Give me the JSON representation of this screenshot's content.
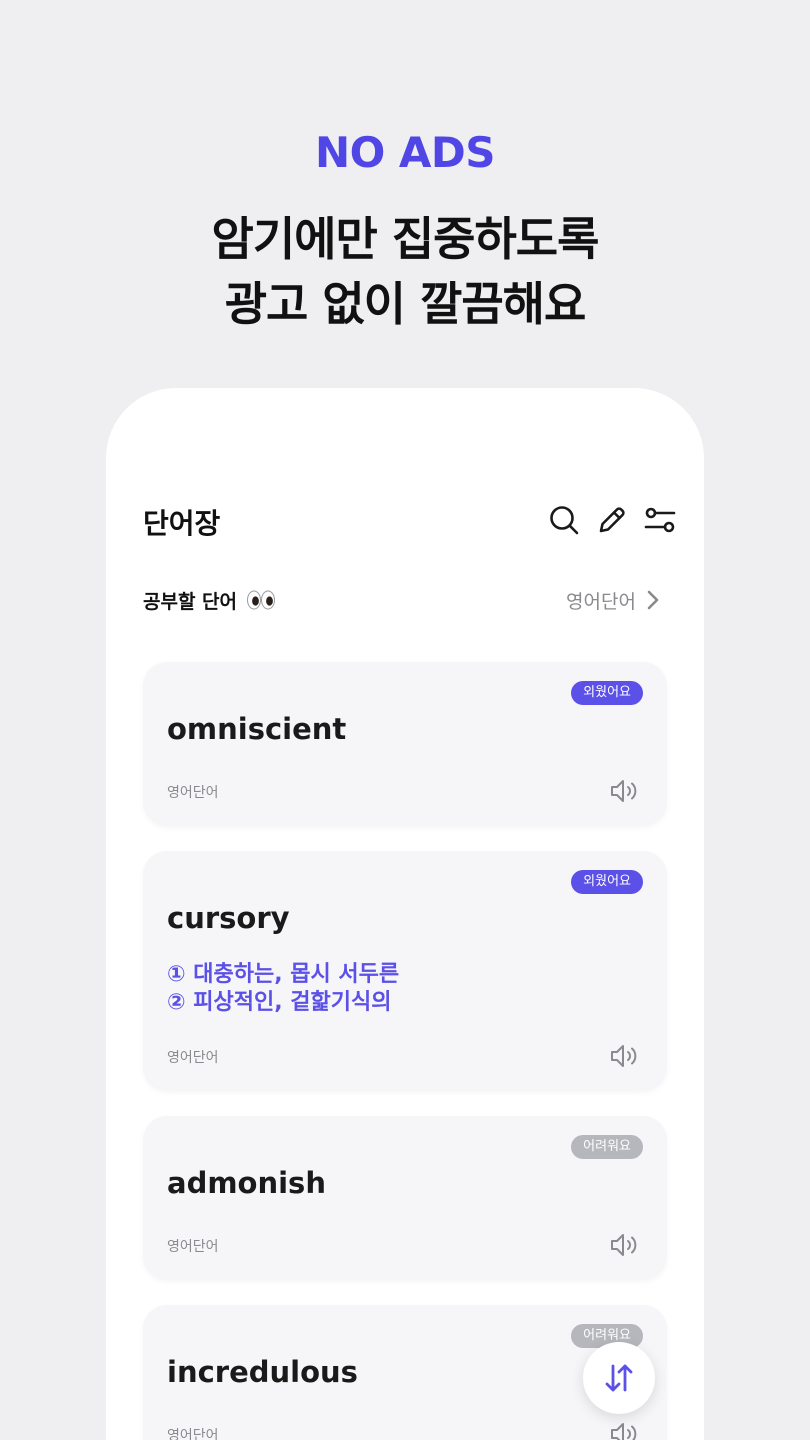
{
  "promo": {
    "badge": "NO ADS",
    "headline_line1": "암기에만 집중하도록",
    "headline_line2": "광고 없이 깔끔해요"
  },
  "header": {
    "title": "단어장",
    "icons": [
      "search-icon",
      "edit-icon",
      "filter-icon"
    ]
  },
  "section": {
    "label": "공부할 단어",
    "emoji_icon": "eyes-icon",
    "category_label": "영어단어"
  },
  "cards": [
    {
      "word": "omniscient",
      "badge": "외웠어요",
      "category": "영어단어"
    },
    {
      "word": "cursory",
      "badge": "외웠어요",
      "category": "영어단어",
      "meanings": [
        "① 대충하는, 몹시 서두른",
        "② 피상적인, 겉핥기식의"
      ]
    },
    {
      "word": "admonish",
      "badge": "어려워요",
      "category": "영어단어"
    },
    {
      "word": "incredulous",
      "badge": "어려워요",
      "category": "영어단어"
    }
  ],
  "colors": {
    "accent": "#5b50e8",
    "promo_badge": "#5046e5",
    "badge_difficult": "#b6b6bd",
    "background": "#efeff1"
  }
}
